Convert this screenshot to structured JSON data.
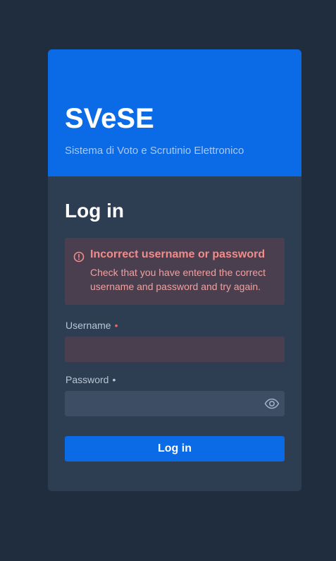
{
  "header": {
    "app_title": "SVeSE",
    "app_subtitle": "Sistema di Voto e Scrutinio Elettronico"
  },
  "form": {
    "title": "Log in",
    "alert": {
      "title": "Incorrect username or password",
      "message": "Check that you have entered the correct username and password and try again."
    },
    "username": {
      "label": "Username",
      "required_mark": "•",
      "value": ""
    },
    "password": {
      "label": "Password",
      "required_mark": "•",
      "value": ""
    },
    "submit_label": "Log in"
  },
  "icons": {
    "alert": "alert-circle-icon",
    "password_toggle": "eye-icon"
  },
  "colors": {
    "background": "#1f2d3f",
    "card": "#2d3e52",
    "accent": "#0b6be6",
    "error_text": "#f38b8b",
    "error_bg": "#4a3f4e"
  }
}
